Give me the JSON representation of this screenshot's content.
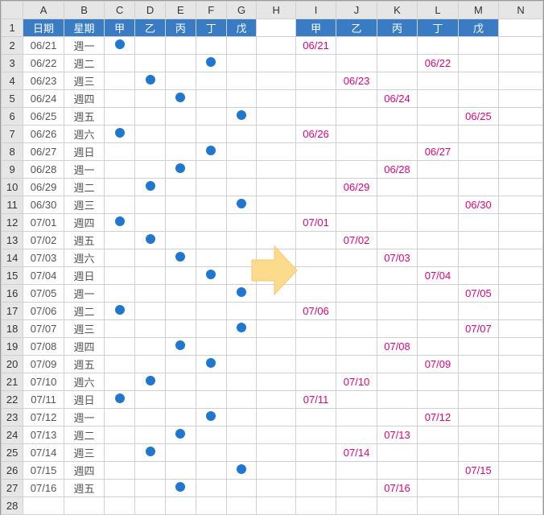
{
  "columns": [
    "A",
    "B",
    "C",
    "D",
    "E",
    "F",
    "G",
    "H",
    "I",
    "J",
    "K",
    "L",
    "M",
    "N"
  ],
  "headerLeft": {
    "A": "日期",
    "B": "星期",
    "C": "甲",
    "D": "乙",
    "E": "丙",
    "F": "丁",
    "G": "戊"
  },
  "headerRight": {
    "I": "甲",
    "J": "乙",
    "K": "丙",
    "L": "丁",
    "M": "戊"
  },
  "persons": [
    "甲",
    "乙",
    "丙",
    "丁",
    "戊"
  ],
  "rows": [
    {
      "date": "06/21",
      "week": "週一",
      "dot": 0
    },
    {
      "date": "06/22",
      "week": "週二",
      "dot": 3
    },
    {
      "date": "06/23",
      "week": "週三",
      "dot": 1
    },
    {
      "date": "06/24",
      "week": "週四",
      "dot": 2
    },
    {
      "date": "06/25",
      "week": "週五",
      "dot": 4
    },
    {
      "date": "06/26",
      "week": "週六",
      "dot": 0
    },
    {
      "date": "06/27",
      "week": "週日",
      "dot": 3
    },
    {
      "date": "06/28",
      "week": "週一",
      "dot": 2
    },
    {
      "date": "06/29",
      "week": "週二",
      "dot": 1
    },
    {
      "date": "06/30",
      "week": "週三",
      "dot": 4
    },
    {
      "date": "07/01",
      "week": "週四",
      "dot": 0
    },
    {
      "date": "07/02",
      "week": "週五",
      "dot": 1
    },
    {
      "date": "07/03",
      "week": "週六",
      "dot": 2
    },
    {
      "date": "07/04",
      "week": "週日",
      "dot": 3
    },
    {
      "date": "07/05",
      "week": "週一",
      "dot": 4
    },
    {
      "date": "07/06",
      "week": "週二",
      "dot": 0
    },
    {
      "date": "07/07",
      "week": "週三",
      "dot": 4
    },
    {
      "date": "07/08",
      "week": "週四",
      "dot": 2
    },
    {
      "date": "07/09",
      "week": "週五",
      "dot": 3
    },
    {
      "date": "07/10",
      "week": "週六",
      "dot": 1
    },
    {
      "date": "07/11",
      "week": "週日",
      "dot": 0
    },
    {
      "date": "07/12",
      "week": "週一",
      "dot": 3
    },
    {
      "date": "07/13",
      "week": "週二",
      "dot": 2
    },
    {
      "date": "07/14",
      "week": "週三",
      "dot": 1
    },
    {
      "date": "07/15",
      "week": "週四",
      "dot": 4
    },
    {
      "date": "07/16",
      "week": "週五",
      "dot": 2
    }
  ],
  "chart_data": {
    "type": "table",
    "title": "",
    "left_table": {
      "columns": [
        "日期",
        "星期",
        "甲",
        "乙",
        "丙",
        "丁",
        "戊"
      ],
      "note": "dot column index 0-4 maps to 甲..戊"
    },
    "right_table": {
      "columns": [
        "甲",
        "乙",
        "丙",
        "丁",
        "戊"
      ],
      "values_are": "date text placed in assigned person column"
    }
  }
}
